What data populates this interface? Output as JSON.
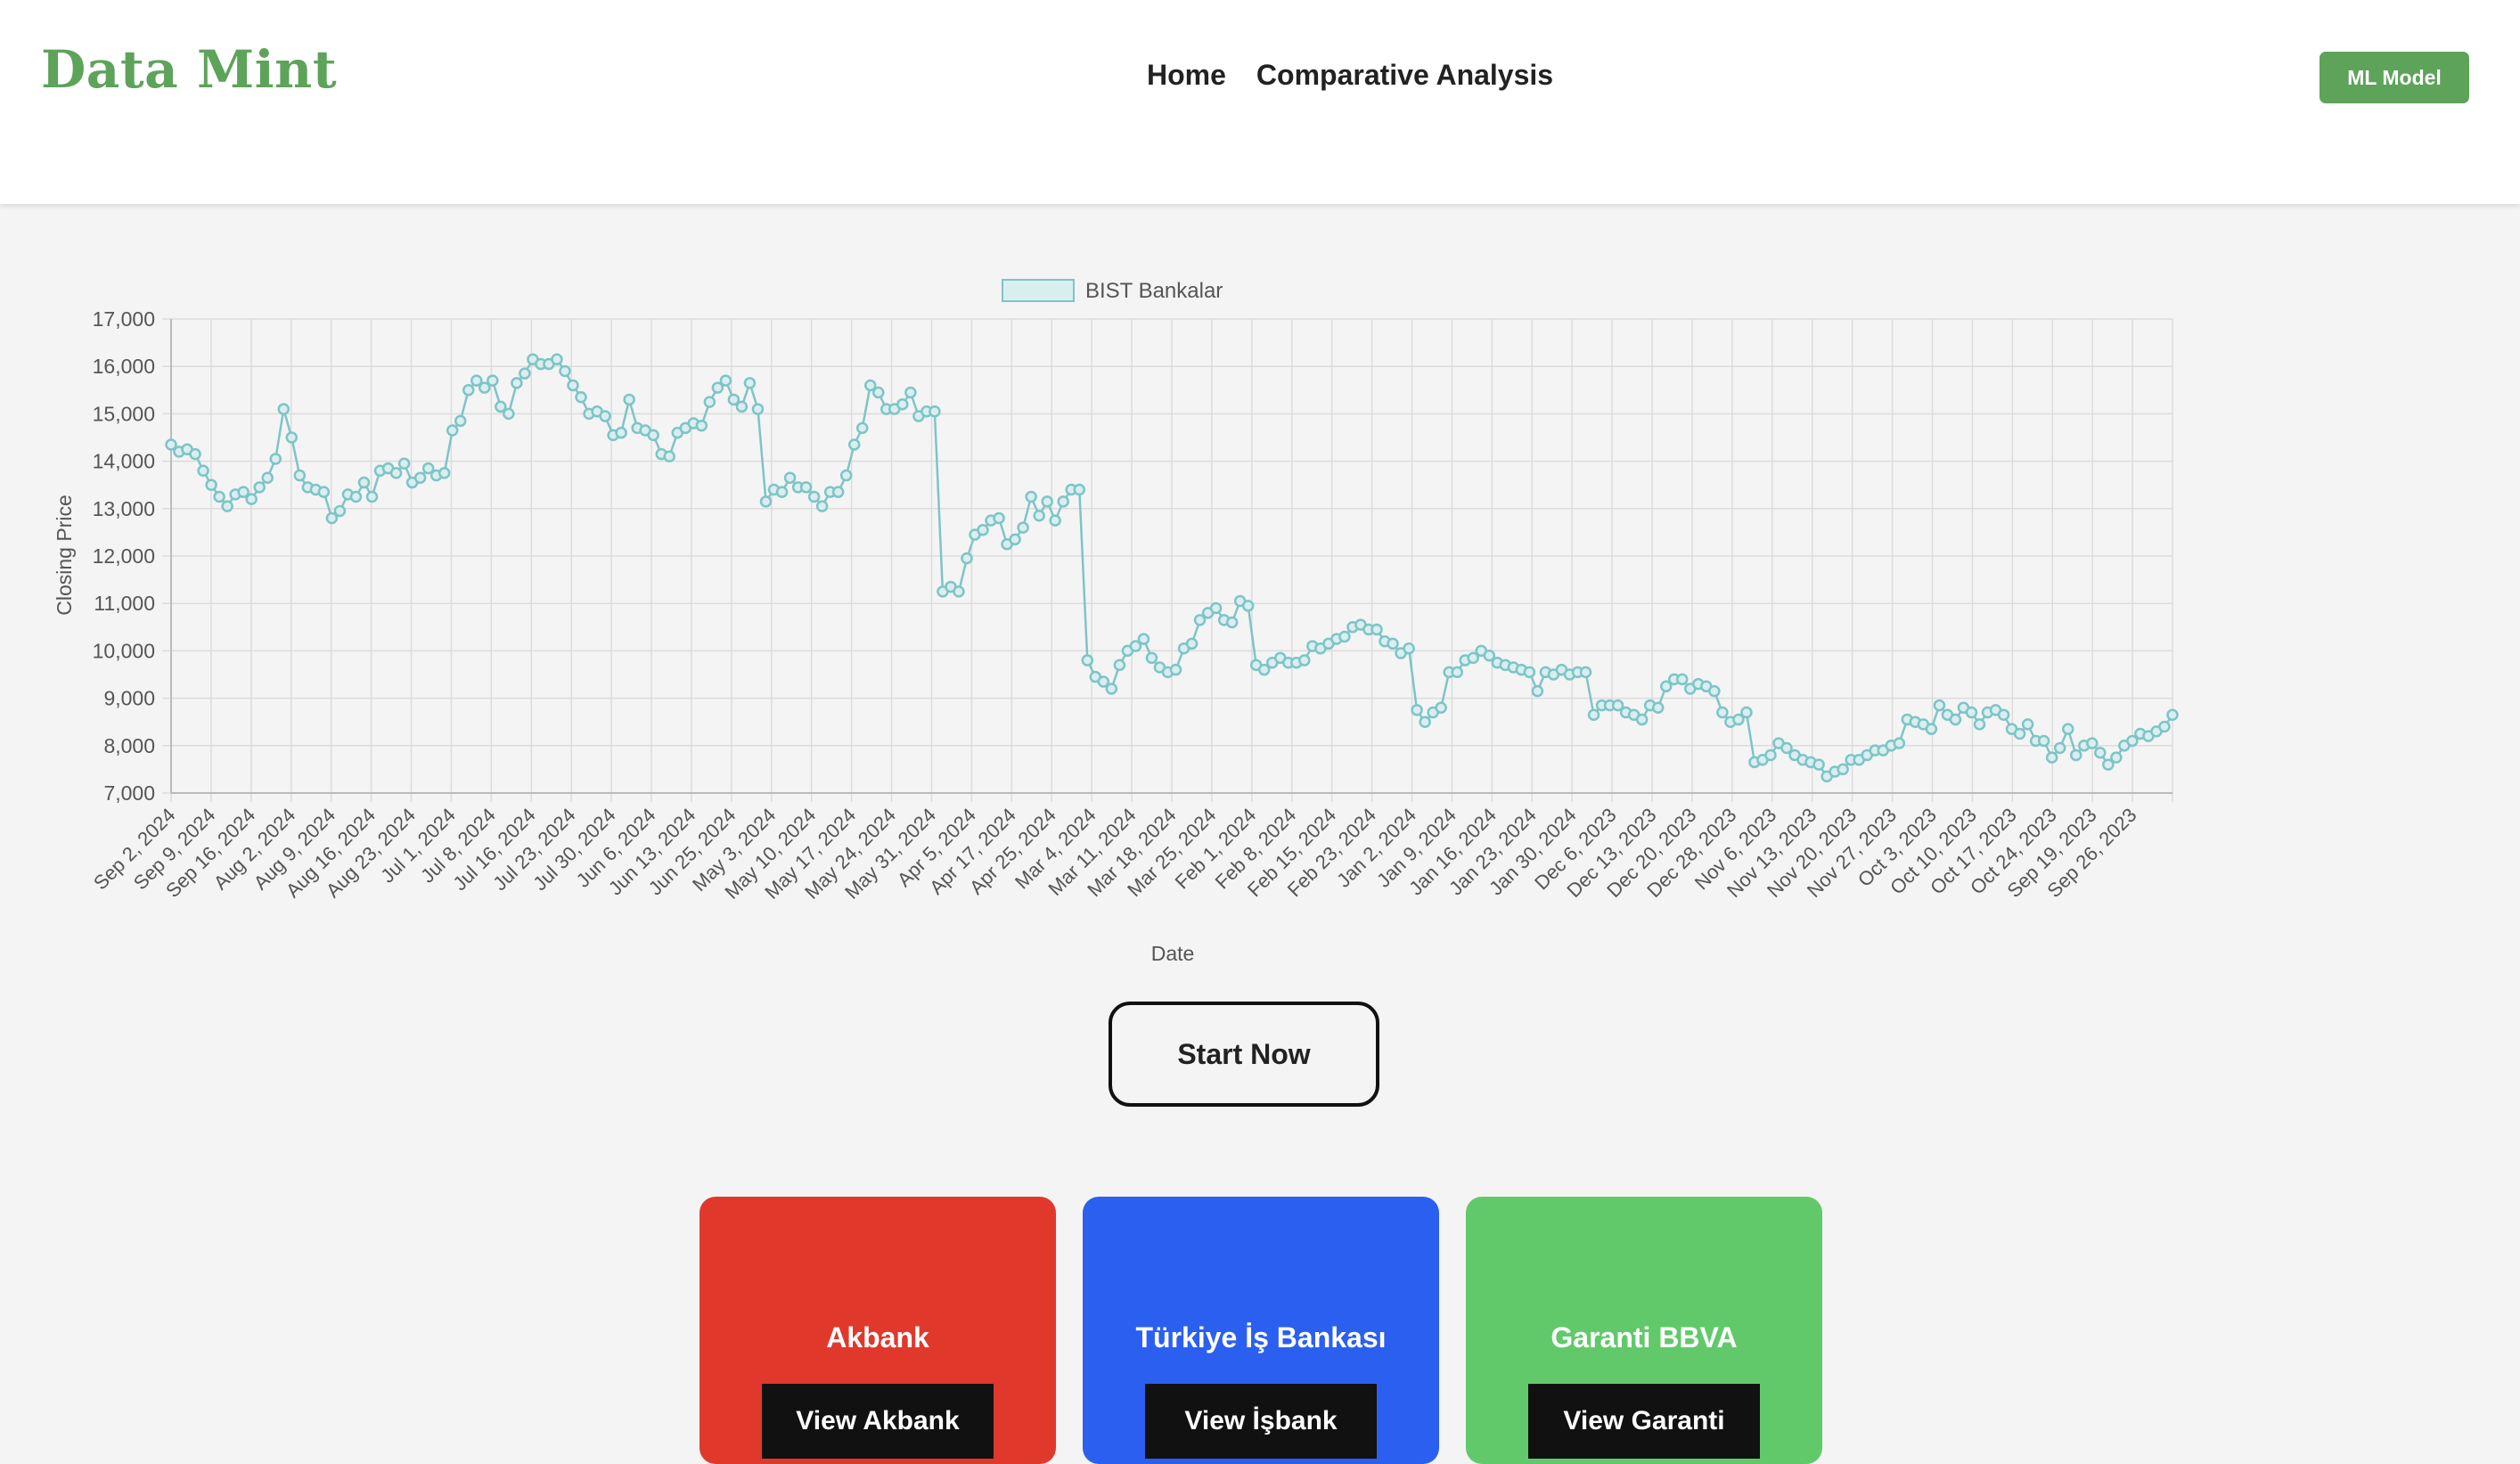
{
  "app": {
    "logo": "Data Mint"
  },
  "nav": {
    "items": [
      "Home",
      "Comparative Analysis"
    ],
    "ml_button": "ML Model"
  },
  "colors": {
    "brand": "#5ea35a",
    "series": "#7ec4c7",
    "akbank": "#e0392c",
    "isbank": "#2b5ff0",
    "garanti": "#62c96a"
  },
  "chart_data": {
    "type": "line",
    "title": "",
    "legend": {
      "label": "BIST Bankalar",
      "position": "top-center"
    },
    "xlabel": "Date",
    "ylabel": "Closing Price",
    "ylim": [
      7000,
      17000
    ],
    "yticks": [
      7000,
      8000,
      9000,
      10000,
      11000,
      12000,
      13000,
      14000,
      15000,
      16000,
      17000
    ],
    "grid": true,
    "x_tick_labels": [
      "Sep 2, 2024",
      "Sep 9, 2024",
      "Sep 16, 2024",
      "Aug 2, 2024",
      "Aug 9, 2024",
      "Aug 16, 2024",
      "Aug 23, 2024",
      "Jul 1, 2024",
      "Jul 8, 2024",
      "Jul 16, 2024",
      "Jul 23, 2024",
      "Jul 30, 2024",
      "Jun 6, 2024",
      "Jun 13, 2024",
      "Jun 25, 2024",
      "May 3, 2024",
      "May 10, 2024",
      "May 17, 2024",
      "May 24, 2024",
      "May 31, 2024",
      "Apr 5, 2024",
      "Apr 17, 2024",
      "Apr 25, 2024",
      "Mar 4, 2024",
      "Mar 11, 2024",
      "Mar 18, 2024",
      "Mar 25, 2024",
      "Feb 1, 2024",
      "Feb 8, 2024",
      "Feb 15, 2024",
      "Feb 23, 2024",
      "Jan 2, 2024",
      "Jan 9, 2024",
      "Jan 16, 2024",
      "Jan 23, 2024",
      "Jan 30, 2024",
      "Dec 6, 2023",
      "Dec 13, 2023",
      "Dec 20, 2023",
      "Dec 28, 2023",
      "Nov 6, 2023",
      "Nov 13, 2023",
      "Nov 20, 2023",
      "Nov 27, 2023",
      "Oct 3, 2023",
      "Oct 10, 2023",
      "Oct 17, 2023",
      "Oct 24, 2023",
      "Sep 19, 2023",
      "Sep 26, 2023"
    ],
    "series": [
      {
        "name": "BIST Bankalar",
        "values": [
          14350,
          14200,
          14250,
          14150,
          13800,
          13500,
          13250,
          13050,
          13300,
          13350,
          13200,
          13450,
          13650,
          14050,
          15100,
          14500,
          13700,
          13450,
          13400,
          13350,
          12800,
          12950,
          13300,
          13250,
          13550,
          13250,
          13800,
          13850,
          13750,
          13950,
          13550,
          13650,
          13850,
          13700,
          13750,
          14650,
          14850,
          15500,
          15700,
          15550,
          15700,
          15150,
          15000,
          15650,
          15850,
          16150,
          16050,
          16050,
          16150,
          15900,
          15600,
          15350,
          15000,
          15050,
          14950,
          14550,
          14600,
          15300,
          14700,
          14650,
          14550,
          14150,
          14100,
          14600,
          14700,
          14800,
          14750,
          15250,
          15550,
          15700,
          15300,
          15150,
          15650,
          15100,
          13150,
          13400,
          13350,
          13650,
          13450,
          13450,
          13250,
          13050,
          13350,
          13350,
          13700,
          14350,
          14700,
          15600,
          15450,
          15100,
          15100,
          15200,
          15450,
          14950,
          15050,
          15050,
          11250,
          11350,
          11250,
          11950,
          12450,
          12550,
          12750,
          12800,
          12250,
          12350,
          12600,
          13250,
          12850,
          13150,
          12750,
          13150,
          13400,
          13400,
          9800,
          9450,
          9350,
          9200,
          9700,
          10000,
          10100,
          10250,
          9850,
          9650,
          9550,
          9600,
          10050,
          10150,
          10650,
          10800,
          10900,
          10650,
          10600,
          11050,
          10950,
          9700,
          9600,
          9750,
          9850,
          9750,
          9750,
          9800,
          10100,
          10050,
          10150,
          10250,
          10300,
          10500,
          10550,
          10450,
          10450,
          10200,
          10150,
          9950,
          10050,
          8750,
          8500,
          8700,
          8800,
          9550,
          9550,
          9800,
          9850,
          10000,
          9900,
          9750,
          9700,
          9650,
          9600,
          9550,
          9150,
          9550,
          9500,
          9600,
          9500,
          9550,
          9550,
          8650,
          8850,
          8850,
          8850,
          8700,
          8650,
          8550,
          8850,
          8800,
          9250,
          9400,
          9400,
          9200,
          9300,
          9250,
          9150,
          8700,
          8500,
          8550,
          8700,
          7650,
          7700,
          7800,
          8050,
          7950,
          7800,
          7700,
          7650,
          7600,
          7350,
          7450,
          7500,
          7700,
          7700,
          7800,
          7900,
          7900,
          8000,
          8050,
          8550,
          8500,
          8450,
          8350,
          8850,
          8650,
          8550,
          8800,
          8700,
          8450,
          8700,
          8750,
          8650,
          8350,
          8250,
          8450,
          8100,
          8100,
          7750,
          7950,
          8350,
          7800,
          8000,
          8050,
          7850,
          7600,
          7750,
          8000,
          8100,
          8250,
          8200,
          8300,
          8400,
          8650
        ]
      }
    ]
  },
  "start_button": "Start Now",
  "cards": [
    {
      "title": "Akbank",
      "button": "View Akbank"
    },
    {
      "title": "Türkiye İş Bankası",
      "button": "View İşbank"
    },
    {
      "title": "Garanti BBVA",
      "button": "View Garanti"
    }
  ]
}
